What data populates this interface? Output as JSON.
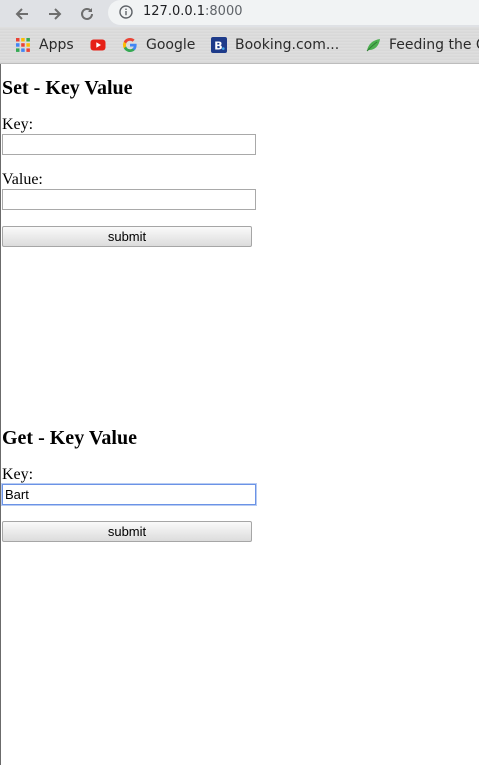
{
  "browser": {
    "url_host": "127.0.0.1",
    "url_port": ":8000"
  },
  "bookmarks": [
    {
      "label": "Apps",
      "icon": "apps-grid-icon"
    },
    {
      "label": "",
      "icon": "youtube-icon"
    },
    {
      "label": "Google",
      "icon": "google-icon"
    },
    {
      "label": "Booking.com...",
      "icon": "booking-icon"
    },
    {
      "label": "Feeding the C",
      "icon": "leaf-icon"
    }
  ],
  "set_form": {
    "title": "Set - Key Value",
    "key_label": "Key:",
    "key_value": "",
    "value_label": "Value:",
    "value_value": "",
    "submit_label": "submit"
  },
  "get_form": {
    "title": "Get - Key Value",
    "key_label": "Key:",
    "key_value": "Bart",
    "submit_label": "submit"
  }
}
